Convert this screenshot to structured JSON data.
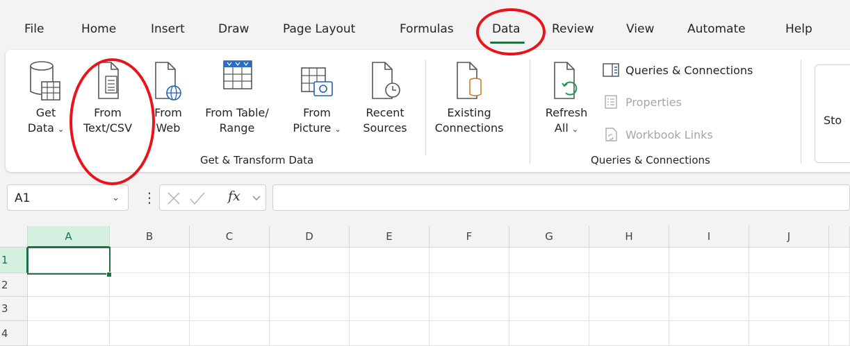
{
  "tabs": [
    "File",
    "Home",
    "Insert",
    "Draw",
    "Page Layout",
    "Formulas",
    "Data",
    "Review",
    "View",
    "Automate",
    "Help"
  ],
  "active_tab": "Data",
  "ribbon": {
    "get_data": {
      "line1": "Get",
      "line2": "Data"
    },
    "from_text_csv": {
      "line1": "From",
      "line2": "Text/CSV"
    },
    "from_web": {
      "line1": "From",
      "line2": "Web"
    },
    "from_table_range": {
      "line1": "From Table/",
      "line2": "Range"
    },
    "from_picture": {
      "line1": "From",
      "line2": "Picture"
    },
    "recent_sources": {
      "line1": "Recent",
      "line2": "Sources"
    },
    "existing_connections": {
      "line1": "Existing",
      "line2": "Connections"
    },
    "get_transform_label": "Get & Transform Data",
    "refresh_all": {
      "line1": "Refresh",
      "line2": "All"
    },
    "queries_connections_item": "Queries & Connections",
    "properties_item": "Properties",
    "workbook_links_item": "Workbook Links",
    "queries_connections_label": "Queries & Connections",
    "stocks_partial": "Sto"
  },
  "formula_bar": {
    "name_box": "A1",
    "fx": "fx",
    "value": ""
  },
  "grid": {
    "columns": [
      "A",
      "B",
      "C",
      "D",
      "E",
      "F",
      "G",
      "H",
      "I",
      "J"
    ],
    "rows": [
      "1",
      "2",
      "3",
      "4"
    ],
    "selected_cell": "A1"
  },
  "colors": {
    "accent": "#1e7145",
    "annotation": "#e8141a"
  }
}
